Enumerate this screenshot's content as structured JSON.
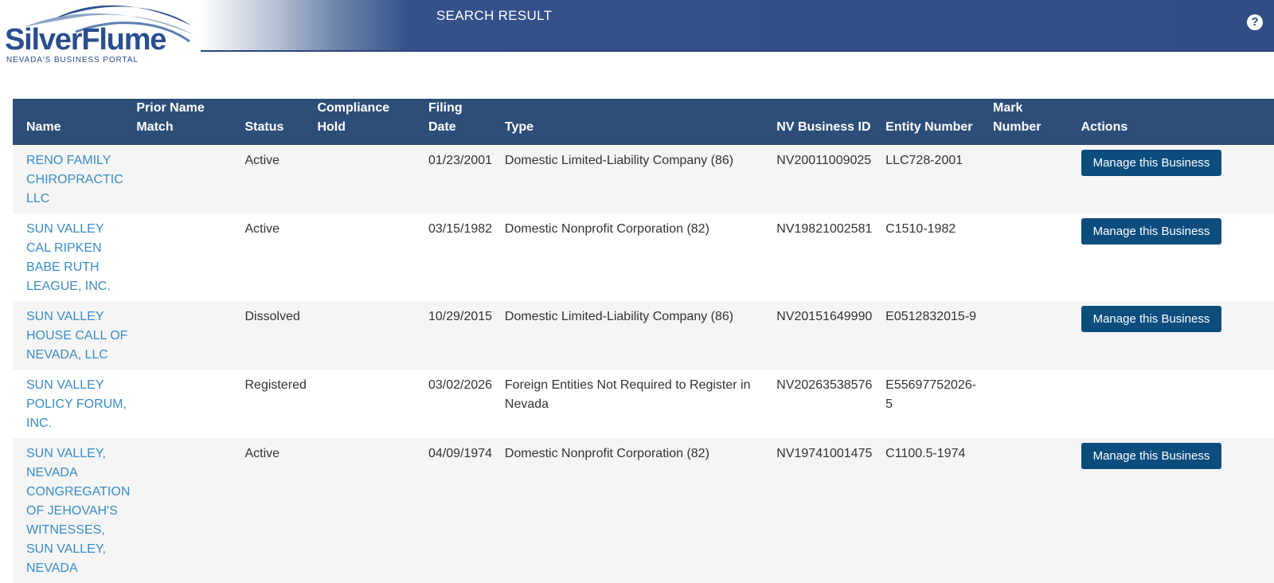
{
  "logo": {
    "name": "SilverFlume",
    "tagline": "NEVADA'S BUSINESS PORTAL"
  },
  "header": {
    "title": "SEARCH RESULT",
    "help_icon": "question-circle-icon",
    "help_glyph": "?"
  },
  "colors": {
    "header_bar": "#304d86",
    "table_header": "#2d4e78",
    "link": "#3a8cc6",
    "button": "#0c4d7e",
    "row_alt": "#f5f5f5"
  },
  "table": {
    "headers": {
      "name": "Name",
      "prior_name_1": "Prior Name",
      "prior_name_2": "Match",
      "status": "Status",
      "compliance_1": "Compliance",
      "compliance_2": "Hold",
      "filing_1": "Filing",
      "filing_2": "Date",
      "type": "Type",
      "nv_id": "NV Business ID",
      "entity": "Entity Number",
      "mark_1": "Mark",
      "mark_2": "Number",
      "actions": "Actions"
    },
    "action_label": "Manage this Business",
    "rows": [
      {
        "name_lines": [
          "RENO FAMILY",
          "CHIROPRACTIC",
          "LLC"
        ],
        "prior_name": "",
        "status": "Active",
        "compliance_hold": "",
        "filing_date": "01/23/2001",
        "type_lines": [
          "Domestic Limited-Liability Company (86)"
        ],
        "nv_id": "NV20011009025",
        "entity_lines": [
          "LLC728-2001"
        ],
        "mark": "",
        "action": "Manage this Business"
      },
      {
        "name_lines": [
          "SUN VALLEY",
          "CAL RIPKEN",
          "BABE RUTH",
          "LEAGUE, INC."
        ],
        "prior_name": "",
        "status": "Active",
        "compliance_hold": "",
        "filing_date": "03/15/1982",
        "type_lines": [
          "Domestic Nonprofit Corporation (82)"
        ],
        "nv_id": "NV19821002581",
        "entity_lines": [
          "C1510-1982"
        ],
        "mark": "",
        "action": "Manage this Business"
      },
      {
        "name_lines": [
          "SUN VALLEY",
          "HOUSE CALL OF",
          "NEVADA, LLC"
        ],
        "prior_name": "",
        "status": "Dissolved",
        "compliance_hold": "",
        "filing_date": "10/29/2015",
        "type_lines": [
          "Domestic Limited-Liability Company (86)"
        ],
        "nv_id": "NV20151649990",
        "entity_lines": [
          "E0512832015-9"
        ],
        "mark": "",
        "action": "Manage this Business"
      },
      {
        "name_lines": [
          "SUN VALLEY",
          "POLICY FORUM,",
          "INC."
        ],
        "prior_name": "",
        "status": "Registered",
        "compliance_hold": "",
        "filing_date": "03/02/2026",
        "type_lines": [
          "Foreign Entities Not Required to Register in",
          "Nevada"
        ],
        "nv_id": "NV20263538576",
        "entity_lines": [
          "E55697752026-",
          "5"
        ],
        "mark": "",
        "action": ""
      },
      {
        "name_lines": [
          "SUN VALLEY,",
          "NEVADA",
          "CONGREGATION",
          "OF JEHOVAH'S",
          "WITNESSES,",
          "SUN VALLEY,",
          "NEVADA"
        ],
        "prior_name": "",
        "status": "Active",
        "compliance_hold": "",
        "filing_date": "04/09/1974",
        "type_lines": [
          "Domestic Nonprofit Corporation (82)"
        ],
        "nv_id": "NV19741001475",
        "entity_lines": [
          "C1100.5-1974"
        ],
        "mark": "",
        "action": "Manage this Business"
      }
    ]
  }
}
